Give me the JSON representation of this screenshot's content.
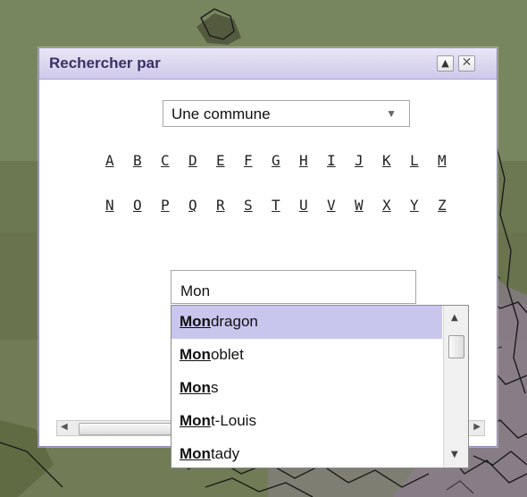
{
  "dialog": {
    "title": "Rechercher par",
    "restore_icon": "▲",
    "close_icon": "✕"
  },
  "search_type": {
    "selected": "Une commune",
    "arrow": "▼"
  },
  "letters": {
    "row1": [
      "A",
      "B",
      "C",
      "D",
      "E",
      "F",
      "G",
      "H",
      "I",
      "J",
      "K",
      "L",
      "M"
    ],
    "row2": [
      "N",
      "O",
      "P",
      "Q",
      "R",
      "S",
      "T",
      "U",
      "V",
      "W",
      "X",
      "Y",
      "Z"
    ]
  },
  "search": {
    "value": "Mon"
  },
  "suggestions": {
    "items": [
      {
        "match": "Mon",
        "rest": "dragon"
      },
      {
        "match": "Mon",
        "rest": "oblet"
      },
      {
        "match": "Mon",
        "rest": "s"
      },
      {
        "match": "Mon",
        "rest": "t-Louis"
      },
      {
        "match": "Mon",
        "rest": "tady"
      }
    ],
    "highlighted_index": 0
  },
  "colors": {
    "titlebar": "#cfc9ea",
    "highlight": "#c9c6ee",
    "title_text": "#3b3166"
  }
}
